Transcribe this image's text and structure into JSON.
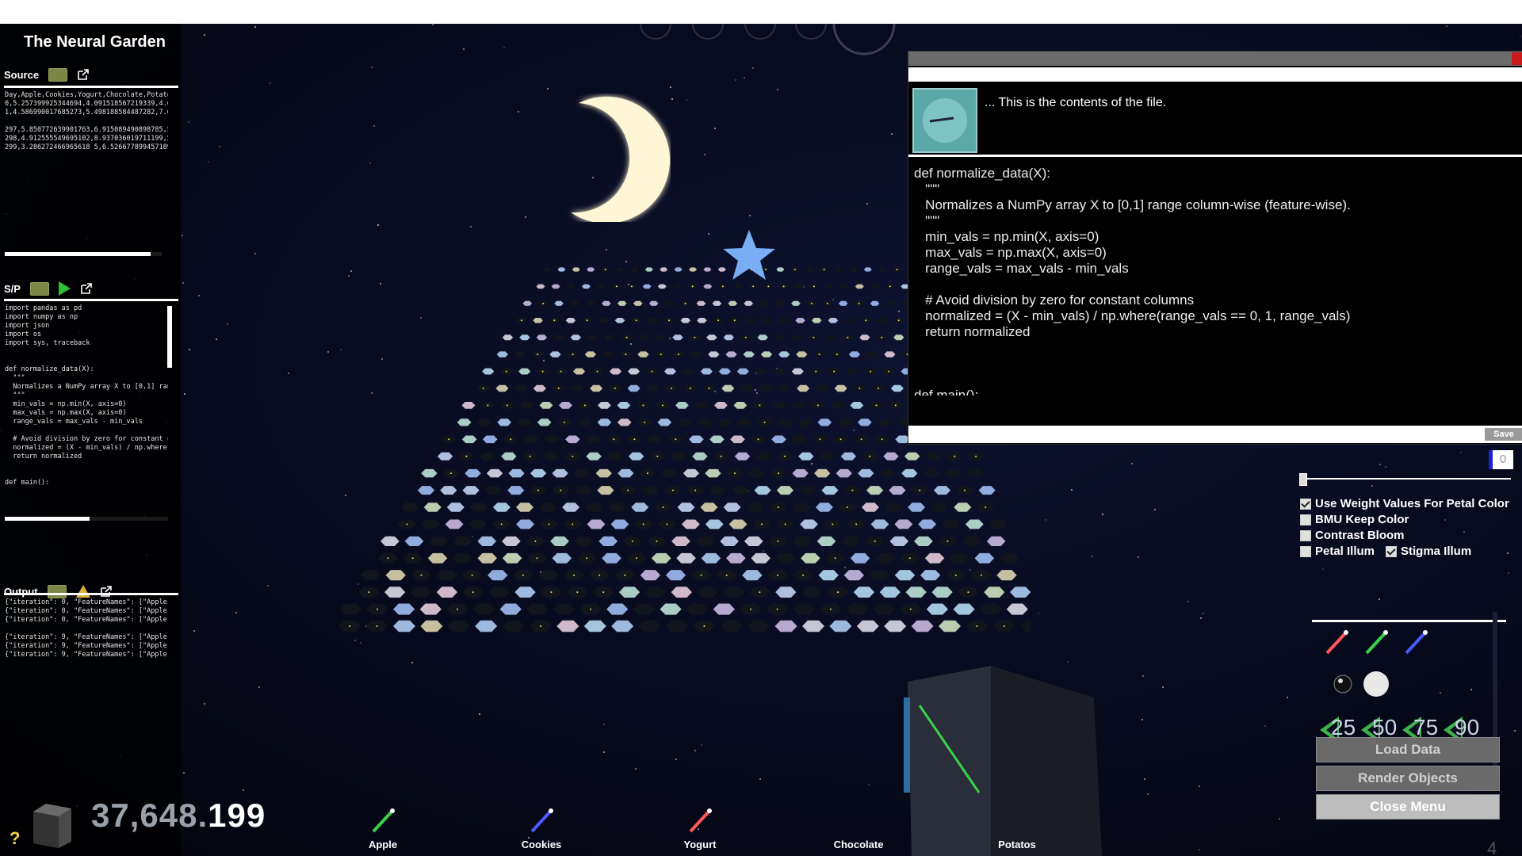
{
  "app": {
    "title": "The Neural Garden"
  },
  "source": {
    "label": "Source",
    "folder_icon": "folder-icon",
    "external_icon": "external-link-icon",
    "lines": "Day,Apple,Cookies,Yogurt,Chocolate,Potatos\n0,5.257399925344694,4.091518567219339,4.6214968\n1,4.586990017685273,5.498188584487282,7.010199\n\n297,5.850772639901763,6.915089490898785,5.76033\n298,4.912555549695102,8.937036019711199,5.80683\n299,3.286272466965618 5,6.526677899457189,4.969",
    "progress": 0.93
  },
  "script": {
    "label": "S/P",
    "folder_icon": "folder-icon",
    "run_icon": "play-icon",
    "external_icon": "external-link-icon",
    "lines": "import pandas as pd\nimport numpy as np\nimport json\nimport os\nimport sys, traceback\n\n\ndef normalize_data(X):\n  \"\"\"\n  Normalizes a NumPy array X to [0,1] range colum\n  \"\"\"\n  min_vals = np.min(X, axis=0)\n  max_vals = np.max(X, axis=0)\n  range_vals = max_vals - min_vals\n\n  # Avoid division by zero for constant columns\n  normalized = (X - min_vals) / np.where(range_va\n  return normalized\n\n\ndef main():",
    "progress": 0.52
  },
  "output": {
    "label": "Output",
    "folder_icon": "folder-icon",
    "warning_icon": "warning-icon",
    "external_icon": "external-link-icon",
    "lines": "{\"iteration\": 0, \"FeatureNames\": [\"Apple\", \"Cookie\n{\"iteration\": 0, \"FeatureNames\": [\"Apple\", \"Cookie\n{\"iteration\": 0, \"FeatureNames\": [\"Apple\", \"Cookie\n\n{\"iteration\": 9, \"FeatureNames\": [\"Apple\", \"Cookie\n{\"iteration\": 9, \"FeatureNames\": [\"Apple\", \"Cookie\n{\"iteration\": 9, \"FeatureNames\": [\"Apple\", \"Cookie"
  },
  "counter": {
    "dim": "37,648.",
    "bright": "199"
  },
  "help": "?",
  "popup": {
    "header": "... This is the contents of the file.",
    "code": "def normalize_data(X):\n   \"\"\"\n   Normalizes a NumPy array X to [0,1] range column-wise (feature-wise).\n   \"\"\"\n   min_vals = np.min(X, axis=0)\n   max_vals = np.max(X, axis=0)\n   range_vals = max_vals - min_vals\n\n   # Avoid division by zero for constant columns\n   normalized = (X - min_vals) / np.where(range_vals == 0, 1, range_vals)\n   return normalized\n\n\n\ndef main():",
    "save_label": "Save"
  },
  "controls": {
    "number_value": "0",
    "slider_value": 0,
    "checks": [
      {
        "label": "Use Weight Values For Petal Color",
        "checked": true
      },
      {
        "label": "BMU Keep Color",
        "checked": false
      },
      {
        "label": "Contrast Bloom",
        "checked": false
      },
      {
        "label": "Petal Illum",
        "checked": false
      },
      {
        "label": "Stigma Illum",
        "checked": true
      }
    ],
    "percent_buttons": [
      "25",
      "50",
      "75",
      "90"
    ],
    "buttons": {
      "load": "Load Data",
      "render": "Render Objects",
      "close": "Close Menu"
    },
    "corner_number": "4"
  },
  "features": [
    "Apple",
    "Cookies",
    "Yogurt",
    "Chocolate",
    "Potatos"
  ],
  "feature_colors": [
    "#3bd14a",
    "#4a5bff",
    "#ff5a5a"
  ]
}
